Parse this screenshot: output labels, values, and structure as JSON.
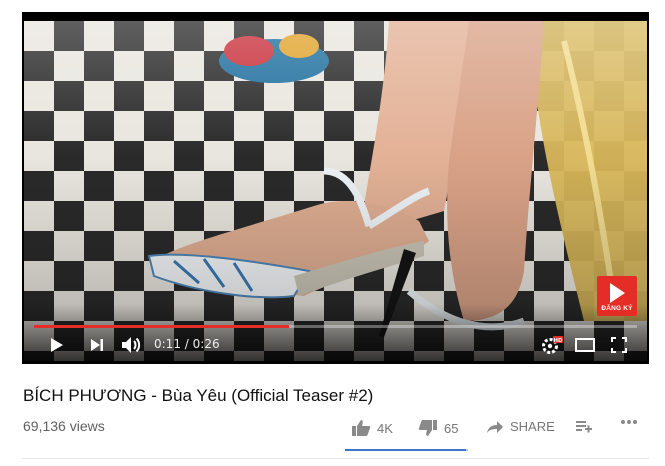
{
  "player": {
    "current_time": "0:11",
    "separator": "/",
    "duration": "0:26",
    "progress_fraction": 0.423,
    "subscribe_label": "ĐĂNG KÝ",
    "accent_color": "#e52d27"
  },
  "video": {
    "title": "BÍCH PHƯƠNG - Bùa Yêu (Official Teaser #2)",
    "views": "69,136 views"
  },
  "actions": {
    "like_count": "4K",
    "dislike_count": "65",
    "share_label": "SHARE",
    "like_ratio": 0.984,
    "like_bar_color": "#3e75c8"
  },
  "icons": [
    "play-icon",
    "next-icon",
    "volume-icon",
    "settings-icon",
    "hd-badge",
    "miniplayer-icon",
    "fullscreen-icon",
    "thumbs-up-icon",
    "thumbs-down-icon",
    "share-icon",
    "add-to-playlist-icon",
    "more-icon"
  ]
}
